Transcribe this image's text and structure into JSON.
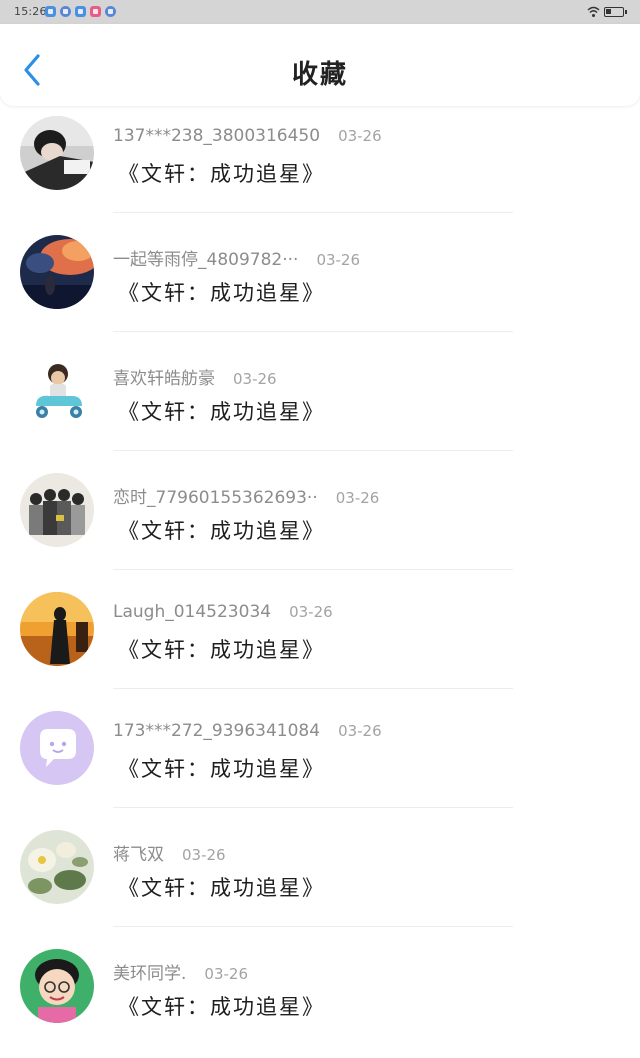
{
  "status_bar": {
    "time": "15:26"
  },
  "header": {
    "title": "收藏",
    "back_icon": "chevron-left-icon",
    "accent_color": "#2b8fe8"
  },
  "favorites": [
    {
      "username": "137***238_3800316450",
      "date": "03-26",
      "title": "《文轩：成功追星》",
      "avatar": "photo-boy-lying"
    },
    {
      "username": "一起等雨停_4809782···",
      "date": "03-26",
      "title": "《文轩：成功追星》",
      "avatar": "anime-sunset-sky"
    },
    {
      "username": "喜欢轩皓舫豪",
      "date": "03-26",
      "title": "《文轩：成功追星》",
      "avatar": "boy-on-scooter"
    },
    {
      "username": "恋时_77960155362693··",
      "date": "03-26",
      "title": "《文轩：成功追星》",
      "avatar": "group-photo"
    },
    {
      "username": "Laugh_014523034",
      "date": "03-26",
      "title": "《文轩：成功追星》",
      "avatar": "sunset-silhouette"
    },
    {
      "username": "173***272_9396341084",
      "date": "03-26",
      "title": "《文轩：成功追星》",
      "avatar": "default-chat-bubble"
    },
    {
      "username": "蒋飞双",
      "date": "03-26",
      "title": "《文轩：成功追星》",
      "avatar": "flower-painting"
    },
    {
      "username": "美环同学.",
      "date": "03-26",
      "title": "《文轩：成功追星》",
      "avatar": "cartoon-girl-glasses"
    }
  ]
}
